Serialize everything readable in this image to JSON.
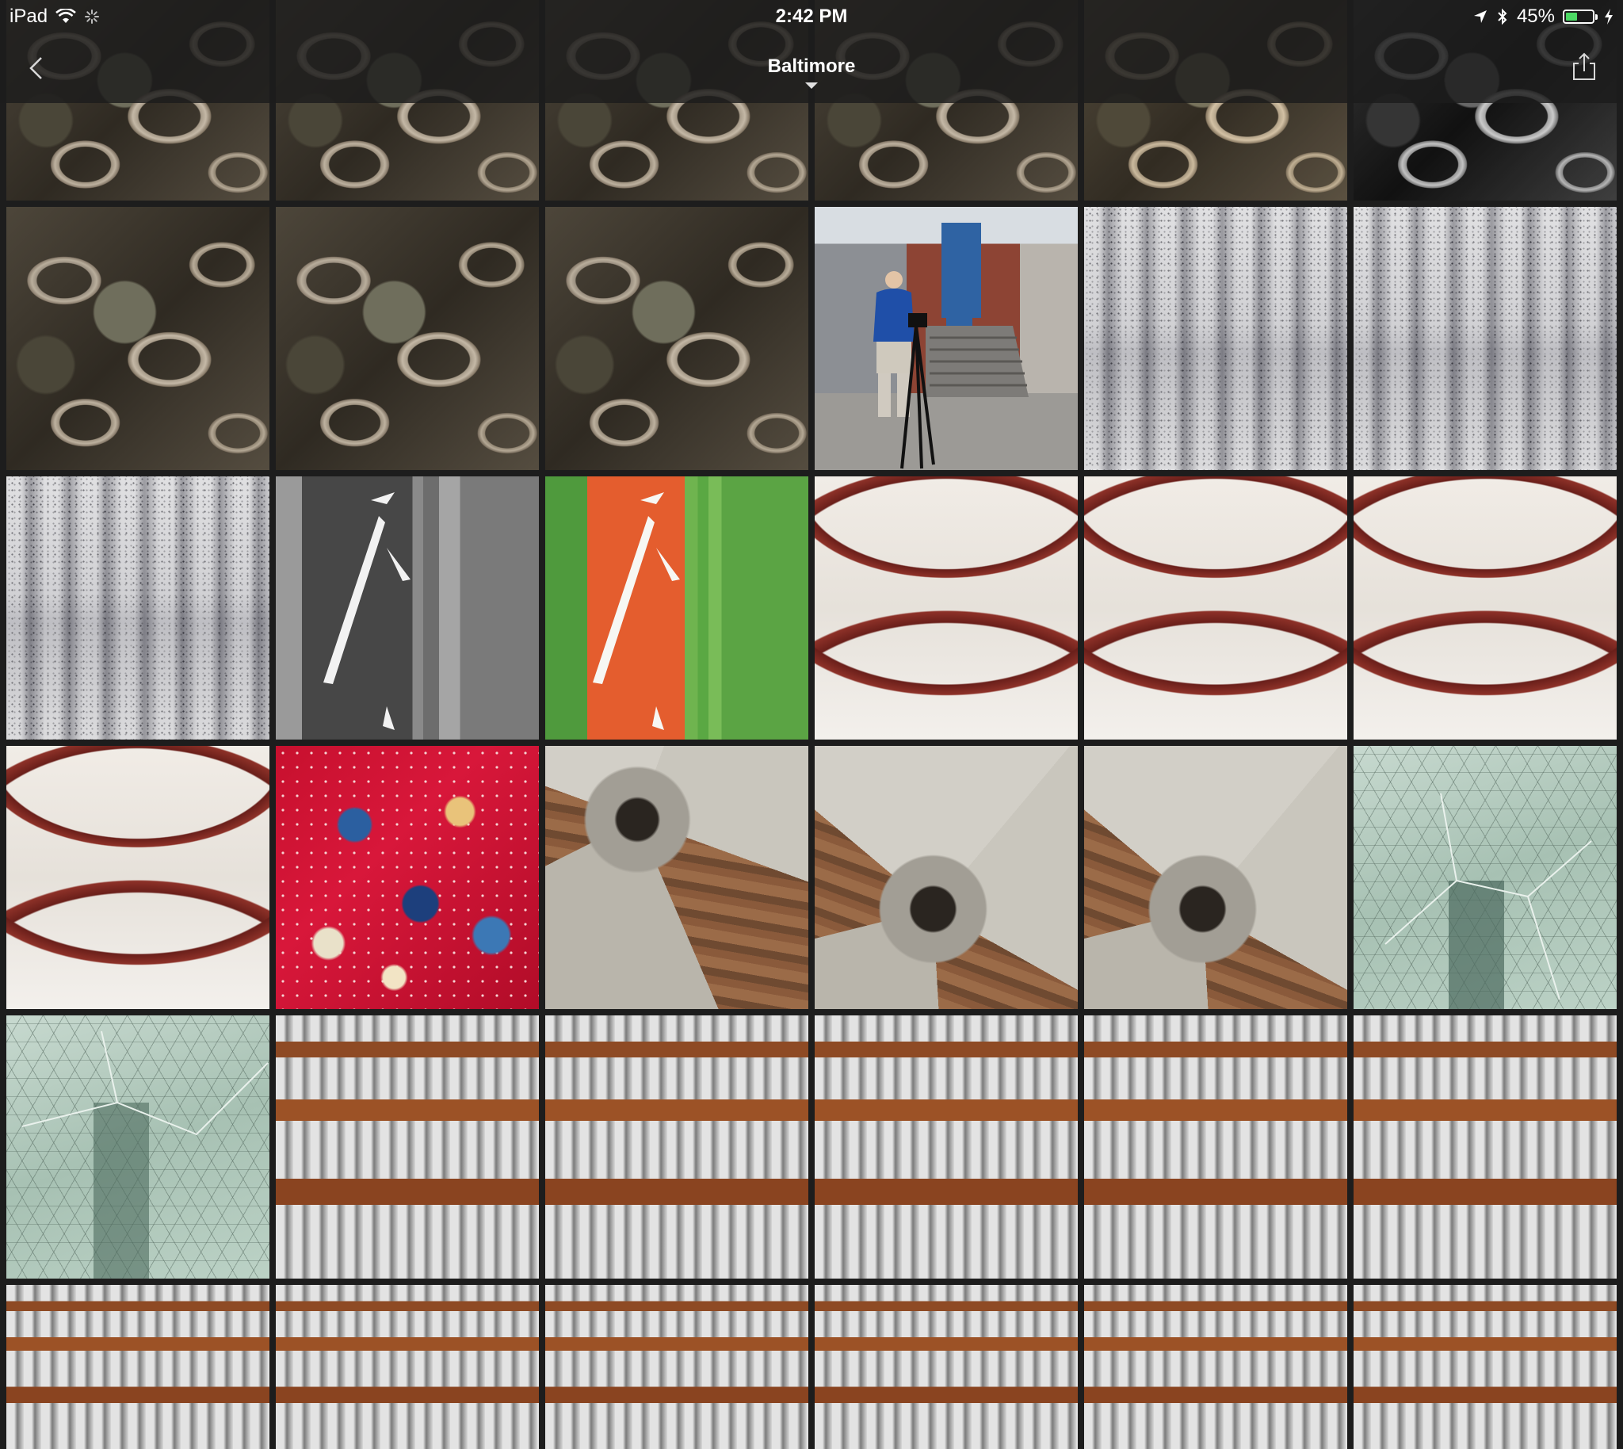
{
  "status_bar": {
    "device": "iPad",
    "time": "2:42 PM",
    "battery_percent": "45%",
    "battery_level": 0.45,
    "icons": [
      "wifi-icon",
      "activity-spinner-icon",
      "location-arrow-icon",
      "bluetooth-icon",
      "battery-icon",
      "charging-bolt-icon"
    ]
  },
  "nav": {
    "back_icon": "chevron-left-icon",
    "title": "Baltimore",
    "share_icon": "share-icon"
  },
  "colors": {
    "bar_background": "#1c1c1c",
    "battery_green": "#4cd964",
    "grid_background": "#1d1d1d"
  },
  "grid": {
    "columns": 6,
    "rows": [
      [
        "chain",
        "chain",
        "chain",
        "chain",
        "chain-warm",
        "chain-bw"
      ],
      [
        "chain",
        "chain",
        "chain",
        "scene",
        "granite",
        "granite"
      ],
      [
        "granite",
        "container-bw",
        "container-color",
        "arches",
        "arches",
        "arches"
      ],
      [
        "arches",
        "rug",
        "prop",
        "prop-center",
        "prop-center",
        "glass"
      ],
      [
        "glass",
        "rails",
        "rails",
        "rails",
        "rails",
        "rails"
      ]
    ]
  }
}
